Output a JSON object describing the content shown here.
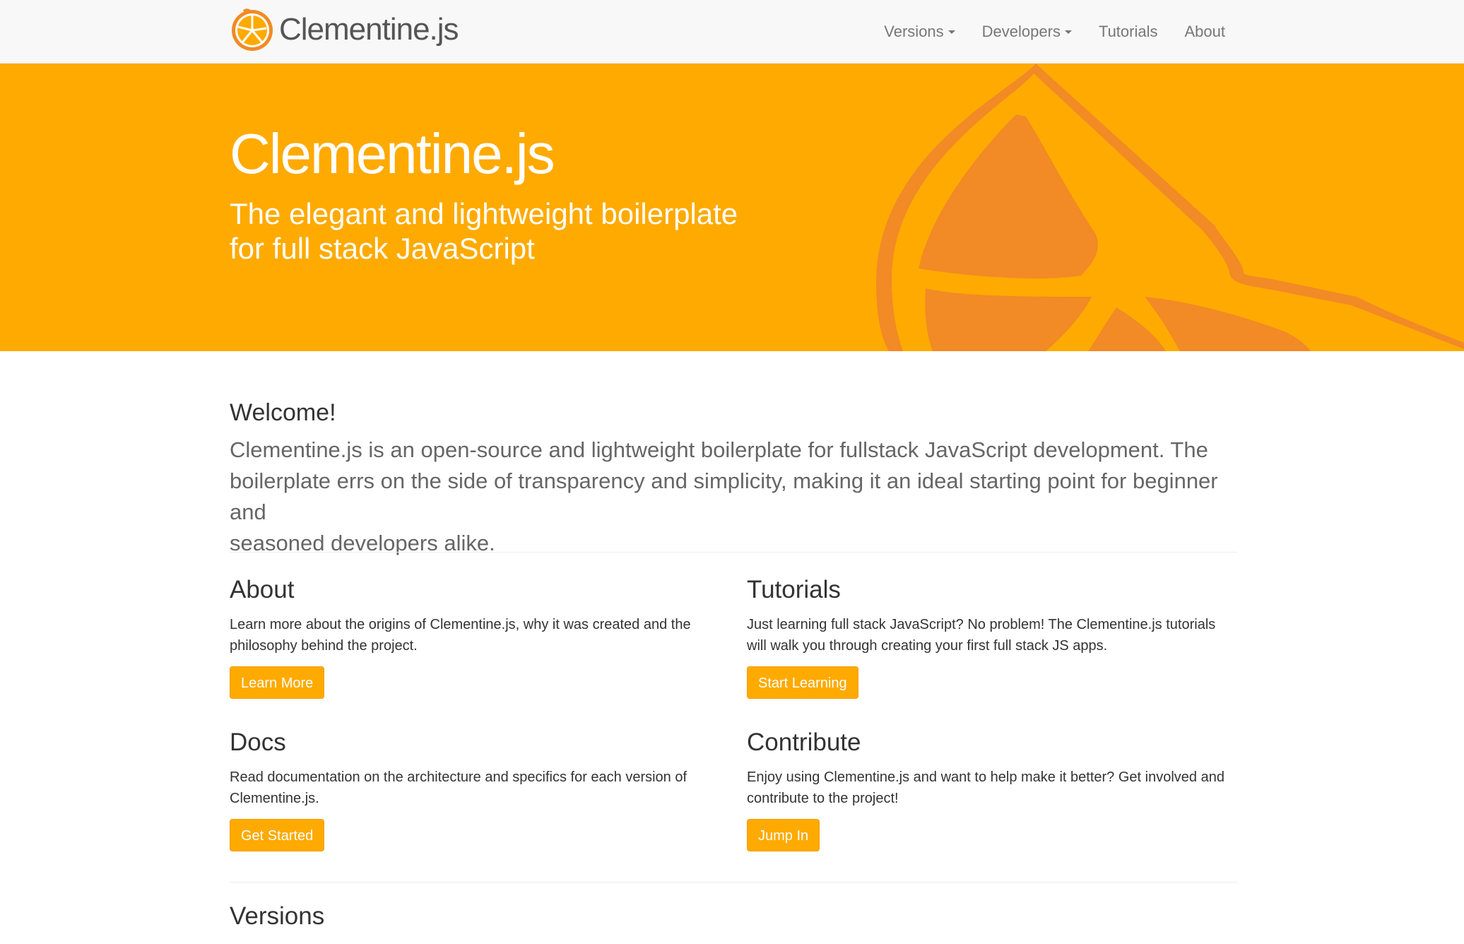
{
  "navbar": {
    "brand": "Clementine.js",
    "items": [
      {
        "label": "Versions",
        "dropdown": true
      },
      {
        "label": "Developers",
        "dropdown": true
      },
      {
        "label": "Tutorials",
        "dropdown": false
      },
      {
        "label": "About",
        "dropdown": false
      }
    ]
  },
  "hero": {
    "title": "Clementine.js",
    "subtitle_line1": "The elegant and lightweight boilerplate",
    "subtitle_line2": "for full stack JavaScript"
  },
  "welcome": {
    "heading": "Welcome!",
    "text_line1": "Clementine.js is an open-source and lightweight boilerplate for fullstack JavaScript development. The",
    "text_line2": "boilerplate errs on the side of transparency and simplicity, making it an ideal starting point for beginner and",
    "text_line3": "seasoned developers alike."
  },
  "cards": {
    "about": {
      "title": "About",
      "line1": "Learn more about the origins of Clementine.js, why it was created and the",
      "line2": "philosophy behind the project.",
      "button": "Learn More"
    },
    "tutorials": {
      "title": "Tutorials",
      "line1": "Just learning full stack JavaScript? No problem! The Clementine.js tutorials",
      "line2": "will walk you through creating your first full stack JS apps.",
      "button": "Start Learning"
    },
    "docs": {
      "title": "Docs",
      "line1": "Read documentation on the architecture and specifics for each version of",
      "line2": "Clementine.js.",
      "button": "Get Started"
    },
    "contribute": {
      "title": "Contribute",
      "line1": "Enjoy using Clementine.js and want to help make it better? Get involved and",
      "line2": "contribute to the project!",
      "button": "Jump In"
    }
  },
  "versions": {
    "heading": "Versions"
  },
  "colors": {
    "accent": "#ffaa00",
    "hero_art": "#f28a25",
    "navbar_bg": "#f8f8f8",
    "nav_text": "#777777"
  },
  "icons": {
    "brand_logo": "clementine-slice-icon",
    "hero_art": "clementine-slice-graphic",
    "dropdown": "caret-down-icon"
  }
}
